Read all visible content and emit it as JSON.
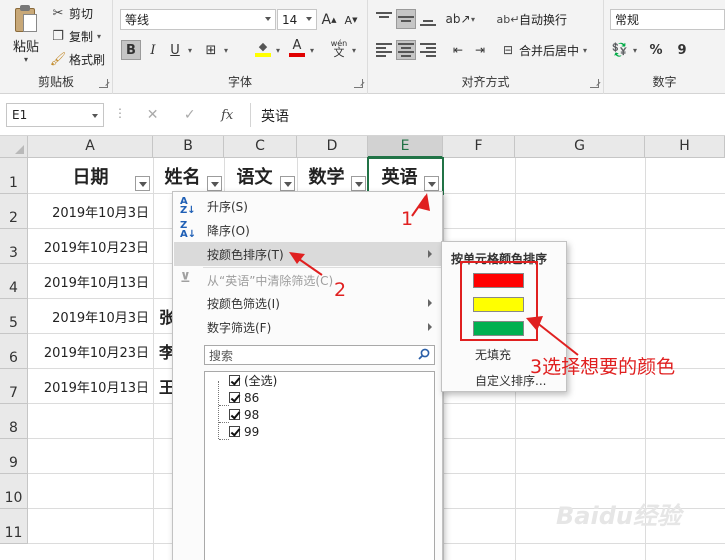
{
  "ribbon": {
    "clipboard": {
      "paste": "粘贴",
      "cut": "剪切",
      "copy": "复制",
      "format_painter": "格式刷",
      "group_label": "剪贴板"
    },
    "font": {
      "font_name": "等线",
      "font_size": "14",
      "grow": "A",
      "shrink": "A",
      "bold": "B",
      "italic": "I",
      "underline": "U",
      "border": "⊞",
      "fill_letter": "◆",
      "font_color_letter": "A",
      "phonetic_top": "wén",
      "phonetic_bottom": "文",
      "group_label": "字体"
    },
    "alignment": {
      "wrap_text": "自动换行",
      "merge_center": "合并后居中",
      "group_label": "对齐方式"
    },
    "number": {
      "format": "常规",
      "percent": "%",
      "comma": "9",
      "group_label": "数字"
    }
  },
  "formula_bar": {
    "name_box": "E1",
    "formula": "英语",
    "fx": "fx",
    "cancel": "✕",
    "enter": "✓"
  },
  "grid": {
    "columns": [
      "A",
      "B",
      "C",
      "D",
      "E",
      "F",
      "G",
      "H"
    ],
    "selected_column": "E",
    "rows": [
      "1",
      "2",
      "3",
      "4",
      "5",
      "6",
      "7",
      "8",
      "9",
      "10",
      "11"
    ],
    "headers": [
      "日期",
      "姓名",
      "语文",
      "数学",
      "英语"
    ],
    "dates": [
      "2019年10月3日",
      "2019年10月23日",
      "2019年10月13日",
      "2019年10月3日",
      "2019年10月23日",
      "2019年10月13日"
    ],
    "name_fragments": [
      "",
      "",
      "",
      "张",
      "李",
      "王"
    ]
  },
  "filter_menu": {
    "sort_asc": "升序(S)",
    "sort_desc": "降序(O)",
    "sort_by_color": "按颜色排序(T)",
    "clear_filter": "从“英语”中清除筛选(C)",
    "filter_by_color": "按颜色筛选(I)",
    "number_filter": "数字筛选(F)",
    "search_placeholder": "搜索",
    "values": [
      "(全选)",
      "86",
      "98",
      "99"
    ]
  },
  "submenu": {
    "title": "按单元格颜色排序",
    "colors": [
      "#ff0000",
      "#ffff00",
      "#00b050"
    ],
    "no_fill": "无填充",
    "custom_sort": "自定义排序..."
  },
  "annotations": {
    "step1": "1",
    "step2": "2",
    "step3": "3选择想要的颜色",
    "color": "#e02020"
  },
  "watermark": "Baidu经验"
}
